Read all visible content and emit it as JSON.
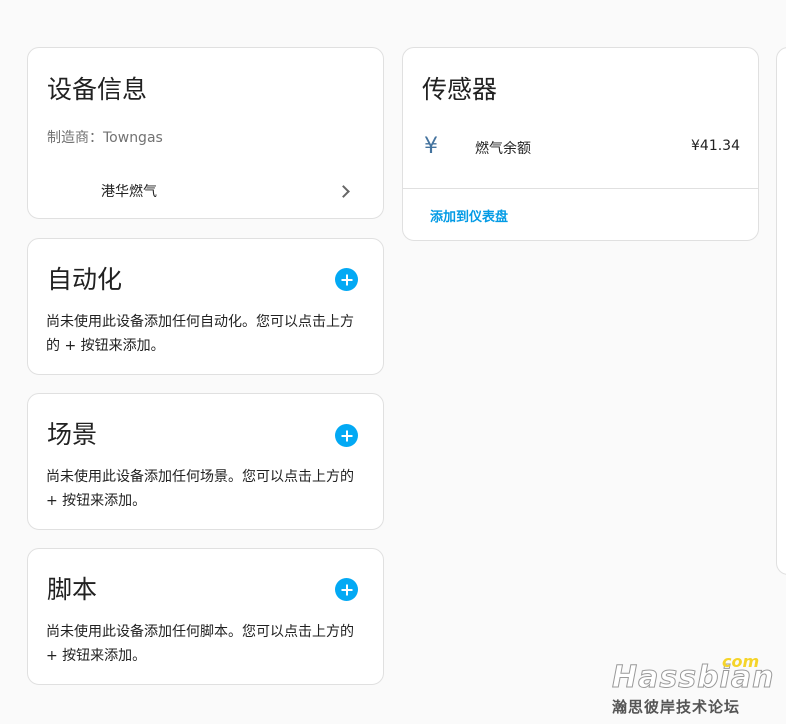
{
  "device_info": {
    "title": "设备信息",
    "manufacturer": "制造商：Towngas",
    "integration_label": "港华燃气"
  },
  "sensors": {
    "title": "传感器",
    "items": [
      {
        "icon": "currency-yuan-icon",
        "icon_glyph": "¥",
        "name": "燃气余额",
        "value": "¥41.34"
      }
    ],
    "add_to_dashboard": "添加到仪表盘"
  },
  "automation": {
    "title": "自动化",
    "description": "尚未使用此设备添加任何自动化。您可以点击上方的 + 按钮来添加。"
  },
  "scene": {
    "title": "场景",
    "description": "尚未使用此设备添加任何场景。您可以点击上方的 + 按钮来添加。"
  },
  "script": {
    "title": "脚本",
    "description": "尚未使用此设备添加任何脚本。您可以点击上方的 + 按钮来添加。"
  },
  "watermark": {
    "brand": "Hassbian",
    "suffix": "com",
    "subtitle": "瀚思彼岸技术论坛"
  },
  "colors": {
    "accent": "#03a9f4",
    "link": "#039be5",
    "card_background": "#ffffff",
    "page_background": "#fafafa"
  }
}
